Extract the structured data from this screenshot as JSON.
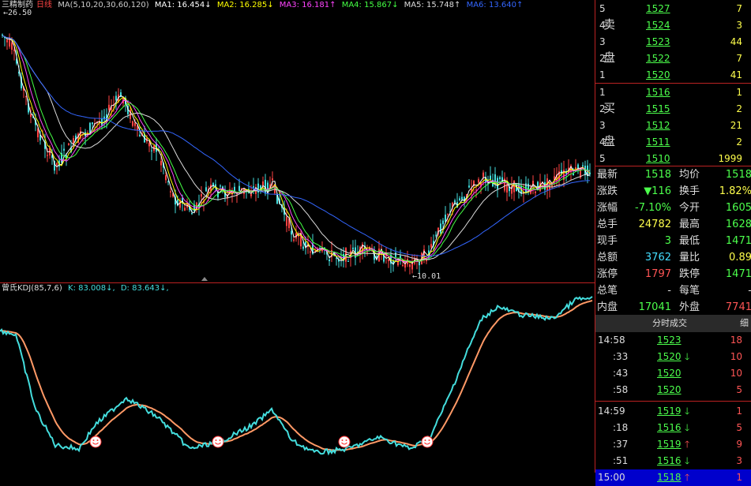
{
  "header": {
    "stock_name": "三精制药",
    "period": "日线",
    "ma_label": "MA(5,10,20,30,60,120)",
    "ma1": "MA1: 16.454↓",
    "ma2": "MA2: 16.285↓",
    "ma3": "MA3: 16.181↑",
    "ma4": "MA4: 15.867↓",
    "ma5": "MA5: 15.748↑",
    "ma6": "MA6: 13.640↑",
    "high_mark": "26.50",
    "low_mark": "10.01",
    "colors": {
      "ma1": "#ffffff",
      "ma2": "#ffff00",
      "ma3": "#ff44ff",
      "ma4": "#44ff44",
      "ma5": "#dddddd",
      "ma6": "#3366ff"
    }
  },
  "indicator": {
    "name": "曾氏KDJ(85,7,6)",
    "k": "K: 83.008↓,",
    "d": "D: 83.643↓,",
    "colors": {
      "k": "#44dddd",
      "d": "#ff9966"
    }
  },
  "orderbook": {
    "sell_label_1": "卖",
    "sell_label_2": "盘",
    "buy_label_1": "买",
    "buy_label_2": "盘",
    "sell": [
      {
        "level": "5",
        "price": "1527",
        "vol": "7"
      },
      {
        "level": "4",
        "price": "1524",
        "vol": "3"
      },
      {
        "level": "3",
        "price": "1523",
        "vol": "44"
      },
      {
        "level": "2",
        "price": "1522",
        "vol": "7"
      },
      {
        "level": "1",
        "price": "1520",
        "vol": "41"
      }
    ],
    "buy": [
      {
        "level": "1",
        "price": "1516",
        "vol": "1"
      },
      {
        "level": "2",
        "price": "1515",
        "vol": "2"
      },
      {
        "level": "3",
        "price": "1512",
        "vol": "21"
      },
      {
        "level": "4",
        "price": "1511",
        "vol": "2"
      },
      {
        "level": "5",
        "price": "1510",
        "vol": "1999"
      }
    ]
  },
  "quote": [
    {
      "k": "最新",
      "v": "1518",
      "vc": "#4cff4c",
      "k2": "均价",
      "v2": "1518",
      "v2c": "#4cff4c"
    },
    {
      "k": "涨跌",
      "v": "▼116",
      "vc": "#4cff4c",
      "k2": "换手",
      "v2": "1.82%",
      "v2c": "#ffff4c"
    },
    {
      "k": "涨幅",
      "v": "-7.10%",
      "vc": "#4cff4c",
      "k2": "今开",
      "v2": "1605",
      "v2c": "#4cff4c"
    },
    {
      "k": "总手",
      "v": "24782",
      "vc": "#ffff4c",
      "k2": "最高",
      "v2": "1628",
      "v2c": "#4cff4c"
    },
    {
      "k": "现手",
      "v": "3",
      "vc": "#4cff4c",
      "k2": "最低",
      "v2": "1471",
      "v2c": "#4cff4c"
    },
    {
      "k": "总额",
      "v": "3762",
      "vc": "#44ddff",
      "k2": "量比",
      "v2": "0.89",
      "v2c": "#ffff4c"
    },
    {
      "k": "涨停",
      "v": "1797",
      "vc": "#ff5555",
      "k2": "跌停",
      "v2": "1471",
      "v2c": "#4cff4c"
    },
    {
      "k": "总笔",
      "v": "-",
      "vc": "#dddddd",
      "k2": "每笔",
      "v2": "-",
      "v2c": "#dddddd"
    },
    {
      "k": "内盘",
      "v": "17041",
      "vc": "#4cff4c",
      "k2": "外盘",
      "v2": "7741",
      "v2c": "#ff5555"
    }
  ],
  "ticks_header": {
    "title": "分时成交",
    "detail": "细"
  },
  "ticks": [
    {
      "time": "14:58",
      "price": "1523",
      "arrow": "",
      "ac": "",
      "n": "18"
    },
    {
      "time": ":33",
      "price": "1520",
      "arrow": "🡓",
      "ac": "#4cff4c",
      "n": "10"
    },
    {
      "time": ":43",
      "price": "1520",
      "arrow": "",
      "ac": "",
      "n": "10"
    },
    {
      "time": ":58",
      "price": "1520",
      "arrow": "",
      "ac": "",
      "n": "5"
    },
    {
      "time": "14:59",
      "price": "1519",
      "arrow": "🡓",
      "ac": "#4cff4c",
      "n": "1"
    },
    {
      "time": ":18",
      "price": "1516",
      "arrow": "🡓",
      "ac": "#4cff4c",
      "n": "5"
    },
    {
      "time": ":37",
      "price": "1519",
      "arrow": "🡑",
      "ac": "#ff5555",
      "n": "9"
    },
    {
      "time": ":51",
      "price": "1516",
      "arrow": "🡓",
      "ac": "#4cff4c",
      "n": "3"
    },
    {
      "time": "15:00",
      "price": "1518",
      "arrow": "🡑",
      "ac": "#ff5555",
      "n": "1"
    }
  ]
}
